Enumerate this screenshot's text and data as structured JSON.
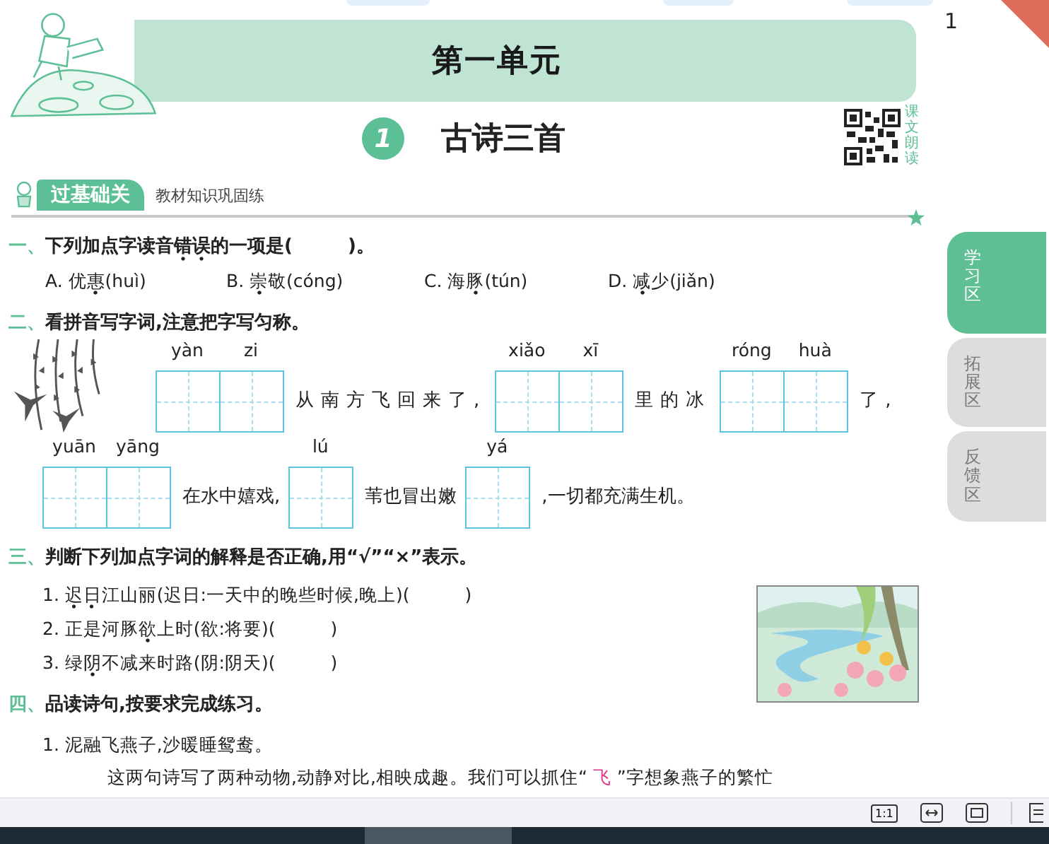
{
  "banner": {
    "title": "第一单元"
  },
  "page_number": "1",
  "lesson": {
    "number": "1",
    "title": "古诗三首",
    "qr_caption": "课文朗读"
  },
  "section": {
    "badge": "过基础关",
    "subtitle": "教材知识巩固练"
  },
  "questions": [
    {
      "kind": "choice",
      "number": "一、",
      "prompt": [
        {
          "text": "下列加点字读音",
          "dotted": false
        },
        {
          "text": "错误",
          "dotted": true
        },
        {
          "text": "的一项是(　　　)。",
          "dotted": false
        }
      ],
      "options": [
        {
          "segments": [
            {
              "text": "A. 优",
              "dotted": false
            },
            {
              "text": "惠",
              "dotted": true
            },
            {
              "text": "(huì)",
              "dotted": false
            }
          ]
        },
        {
          "segments": [
            {
              "text": "B. ",
              "dotted": false
            },
            {
              "text": "崇",
              "dotted": true
            },
            {
              "text": "敬(cóng)",
              "dotted": false
            }
          ]
        },
        {
          "segments": [
            {
              "text": "C. 海",
              "dotted": false
            },
            {
              "text": "豚",
              "dotted": true
            },
            {
              "text": "(tún)",
              "dotted": false
            }
          ]
        },
        {
          "segments": [
            {
              "text": "D. ",
              "dotted": false
            },
            {
              "text": "减",
              "dotted": true
            },
            {
              "text": "少(jiǎn)",
              "dotted": false
            }
          ]
        }
      ]
    },
    {
      "kind": "writing",
      "number": "二、",
      "prompt": [
        {
          "text": "看拼音写字词,注意把字写匀称。",
          "dotted": false
        }
      ],
      "rows": [
        {
          "items": [
            {
              "kind": "illustration"
            },
            {
              "kind": "boxes",
              "pinyin": [
                "yàn",
                "zi"
              ]
            },
            {
              "kind": "text",
              "text": "从南方飞回来了,"
            },
            {
              "kind": "boxes",
              "pinyin": [
                "xiǎo",
                "xī"
              ]
            },
            {
              "kind": "text",
              "text": "里的冰"
            },
            {
              "kind": "boxes",
              "pinyin": [
                "róng",
                "huà"
              ]
            },
            {
              "kind": "text",
              "text": "了,"
            }
          ]
        },
        {
          "items": [
            {
              "kind": "boxes",
              "pinyin": [
                "yuān",
                "yāng"
              ]
            },
            {
              "kind": "text",
              "text": "在水中嬉戏,"
            },
            {
              "kind": "boxes",
              "pinyin": [
                "lú"
              ]
            },
            {
              "kind": "text",
              "text": "苇也冒出嫩"
            },
            {
              "kind": "boxes",
              "pinyin": [
                "yá"
              ]
            },
            {
              "kind": "text",
              "text": ",一切都充满生机。"
            }
          ]
        }
      ]
    },
    {
      "kind": "judge",
      "number": "三、",
      "prompt": [
        {
          "text": "判断下列加点字词的解释是否正确,用“√”“×”表示。",
          "dotted": false
        }
      ],
      "items": [
        {
          "segments": [
            {
              "text": "1. ",
              "dotted": false
            },
            {
              "text": "迟日",
              "dotted": true
            },
            {
              "text": "江山丽(迟日:一天中的晚些时候,晚上)(　　　)",
              "dotted": false
            }
          ]
        },
        {
          "segments": [
            {
              "text": "2. 正是河豚",
              "dotted": false
            },
            {
              "text": "欲",
              "dotted": true
            },
            {
              "text": "上时(欲:将要)(　　　)",
              "dotted": false
            }
          ]
        },
        {
          "segments": [
            {
              "text": "3. 绿",
              "dotted": false
            },
            {
              "text": "阴",
              "dotted": true
            },
            {
              "text": "不减来时路(阴:阴天)(　　　)",
              "dotted": false
            }
          ]
        }
      ]
    },
    {
      "kind": "reading",
      "number": "四、",
      "prompt": [
        {
          "text": "品读诗句,按要求完成练习。",
          "dotted": false
        }
      ],
      "items": [
        "1. 泥融飞燕子,沙暖睡鸳鸯。"
      ],
      "paragraph": [
        {
          "text": "这两句诗写了两种动物,动静对比,相映成趣。我们可以抓住“ ",
          "filled_in": false
        },
        {
          "text": "飞",
          "filled_in": true
        },
        {
          "text": " ”字想象燕子的繁忙",
          "filled_in": false
        }
      ]
    }
  ],
  "side_tabs": [
    {
      "label": "学习区",
      "selected": true
    },
    {
      "label": "拓展区",
      "selected": false
    },
    {
      "label": "反馈区",
      "selected": false
    }
  ],
  "toolbar": {
    "actual_size": "1:1"
  }
}
